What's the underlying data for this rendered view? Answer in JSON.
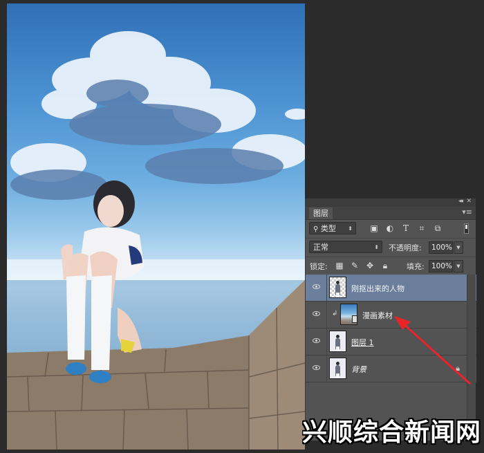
{
  "layers_panel": {
    "tab_label": "图层",
    "panel_menu_icon": "panel-menu-icon",
    "filter": {
      "kind_label": "类型",
      "icon": "search-icon"
    },
    "blend_mode": "正常",
    "opacity_label": "不透明度:",
    "opacity_value": "100%",
    "lock_label": "锁定:",
    "fill_label": "填充:",
    "fill_value": "100%",
    "layers": [
      {
        "name": "刚抠出来的人物",
        "visible": true,
        "selected": true,
        "thumbnail": "checkerboard-with-figure"
      },
      {
        "name": "漫画素材",
        "visible": true,
        "clipped": true,
        "thumbnail": "sky-photo"
      },
      {
        "name": "图层 1",
        "visible": true,
        "thumbnail": "figure-on-white"
      },
      {
        "name": "背景",
        "visible": true,
        "locked": true,
        "thumbnail": "figure-on-white"
      }
    ]
  },
  "canvas": {
    "description_icon": "composite-photo-girl-sitting-on-wall-under-cloudy-sky"
  },
  "annotation": {
    "arrow_color": "#e8242b"
  },
  "watermark": {
    "text": "兴顺综合新闻网"
  },
  "colors": {
    "panel_bg": "#535353",
    "selected_layer": "#6b7f9c",
    "app_bg": "#2b2b2b"
  }
}
